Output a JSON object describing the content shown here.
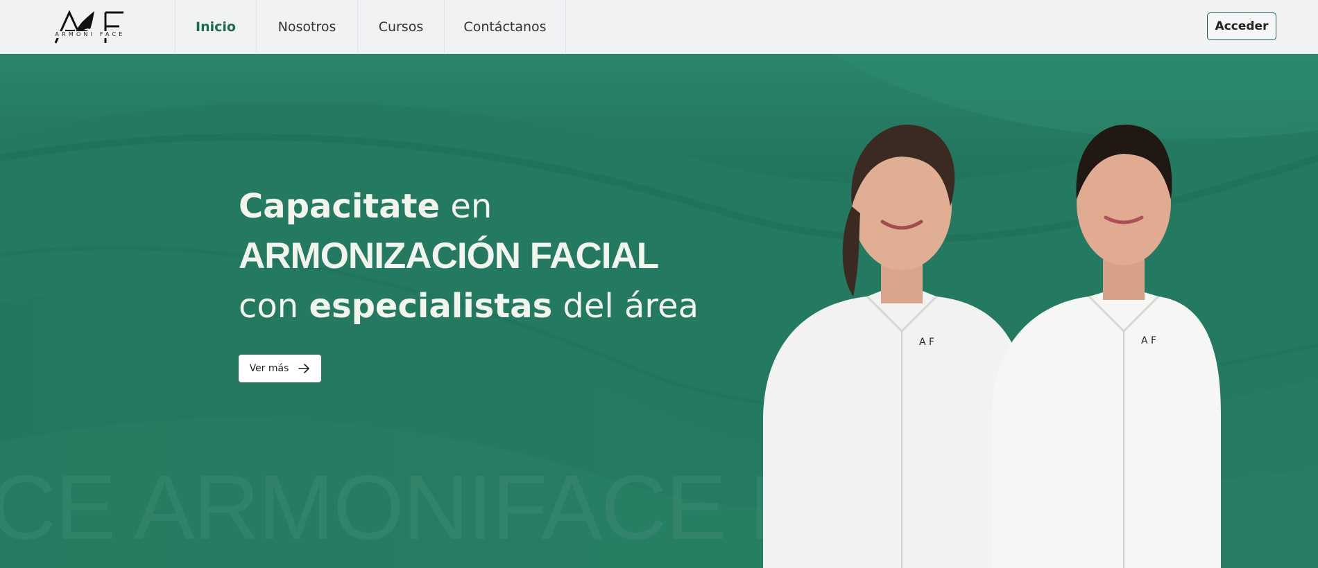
{
  "brand": {
    "logo_text": "ARMONI FACE",
    "colors": {
      "primary": "#247a61",
      "nav_active": "#1c6a4e",
      "navbar_bg": "#f1f2f4"
    }
  },
  "nav": {
    "items": [
      {
        "label": "Inicio",
        "active": true
      },
      {
        "label": "Nosotros",
        "active": false
      },
      {
        "label": "Cursos",
        "active": false
      },
      {
        "label": "Contáctanos",
        "active": false
      }
    ],
    "login_label": "Acceder"
  },
  "hero": {
    "line1": {
      "bold": "Capacitate",
      "light": " en"
    },
    "line2": "ARMONIZACIÓN FACIAL",
    "line3": {
      "pre": "con ",
      "bold": "especialistas",
      "post": " del área"
    },
    "cta_label": "Ver más",
    "cta_icon": "arrow-right-icon",
    "watermark": "CE   ARMONIFACE                                         FAC"
  }
}
